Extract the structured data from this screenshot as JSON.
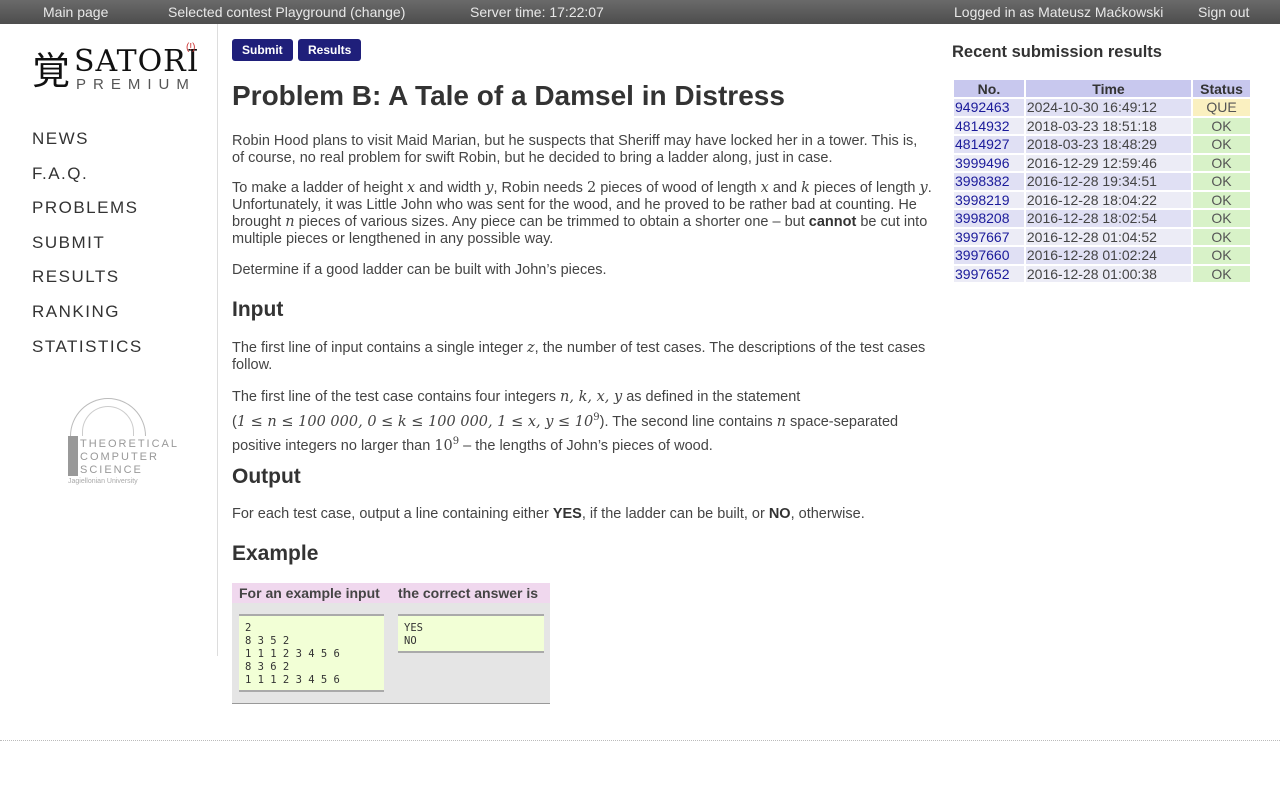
{
  "topbar": {
    "main_page": "Main page",
    "contest": "Selected contest Playground (change)",
    "server_time": "Server time: 17:22:07",
    "logged_in": "Logged in as Mateusz Maćkowski",
    "sign_out": "Sign out"
  },
  "logo": {
    "kanji": "覚",
    "satori": "SATORI",
    "mark": "(!)",
    "premium": "PREMIUM"
  },
  "nav": [
    "NEWS",
    "F.A.Q.",
    "PROBLEMS",
    "SUBMIT",
    "RESULTS",
    "RANKING",
    "STATISTICS"
  ],
  "tcs_logo": {
    "l1": "THEORETICAL",
    "l2": "COMPUTER",
    "l3": "SCIENCE",
    "uni": "Jagiellonian University"
  },
  "buttons": {
    "submit": "Submit",
    "results": "Results"
  },
  "problem": {
    "title": "Problem B: A Tale of a Damsel in Distress",
    "p1": "Robin Hood plans to visit Maid Marian, but he suspects that Sheriff may have locked her in a tower. This is, of course, no real problem for swift Robin, but he decided to bring a ladder along, just in case.",
    "p2a": "To make a ladder of height ",
    "p2b": " and width ",
    "p2c": ", Robin needs ",
    "p2d": " pieces of wood of length ",
    "p2e": " and ",
    "p2f": " pieces of length ",
    "p2g": ". Unfortunately, it was Little John who was sent for the wood, and he proved to be rather bad at counting. He brought ",
    "p2h": " pieces of various sizes. Any piece can be trimmed to obtain a shorter one – but ",
    "p2bold": "cannot",
    "p2i": " be cut into multiple pieces or lengthened in any possible way.",
    "p3": "Determine if a good ladder can be built with John’s pieces.",
    "input_heading": "Input",
    "in1a": "The first line of input contains a single integer ",
    "in1b": ", the number of test cases. The descriptions of the test cases follow.",
    "in2a": "The first line of the test case contains four integers ",
    "in2b": " as defined in the statement",
    "in2c": "(",
    "in2d": "). The second line contains ",
    "in2e": " space-separated",
    "in2f": "positive integers no larger than ",
    "in2g": " – the lengths of John’s pieces of wood.",
    "output_heading": "Output",
    "out1a": "For each test case, output a line containing either ",
    "out1yes": "YES",
    "out1b": ", if the ladder can be built, or ",
    "out1no": "NO",
    "out1c": ", otherwise.",
    "example_heading": "Example",
    "math": {
      "x": "x",
      "y": "y",
      "two": "2",
      "k": "k",
      "n": "n",
      "z": "z",
      "nkxy": "n, k, x, y",
      "constraints": "1 ≤ n ≤ 100 000, 0 ≤ k ≤ 100 000, 1 ≤ x, y ≤ 10",
      "exp9": "9",
      "ten": "10"
    }
  },
  "example": {
    "input_header": "For an example input",
    "output_header": "the correct answer is",
    "input": "2\n8 3 5 2\n1 1 1 2 3 4 5 6\n8 3 6 2\n1 1 1 2 3 4 5 6",
    "output": "YES\nNO"
  },
  "recent": {
    "title": "Recent submission results",
    "headers": [
      "No.",
      "Time",
      "Status"
    ],
    "rows": [
      {
        "no": "9492463",
        "time": "2024-10-30 16:49:12",
        "status": "QUE"
      },
      {
        "no": "4814932",
        "time": "2018-03-23 18:51:18",
        "status": "OK"
      },
      {
        "no": "4814927",
        "time": "2018-03-23 18:48:29",
        "status": "OK"
      },
      {
        "no": "3999496",
        "time": "2016-12-29 12:59:46",
        "status": "OK"
      },
      {
        "no": "3998382",
        "time": "2016-12-28 19:34:51",
        "status": "OK"
      },
      {
        "no": "3998219",
        "time": "2016-12-28 18:04:22",
        "status": "OK"
      },
      {
        "no": "3998208",
        "time": "2016-12-28 18:02:54",
        "status": "OK"
      },
      {
        "no": "3997667",
        "time": "2016-12-28 01:04:52",
        "status": "OK"
      },
      {
        "no": "3997660",
        "time": "2016-12-28 01:02:24",
        "status": "OK"
      },
      {
        "no": "3997652",
        "time": "2016-12-28 01:00:38",
        "status": "OK"
      }
    ]
  },
  "colors": {
    "accent": "#1f1f7a",
    "ok": "#d8f2c8",
    "que": "#faf0c0",
    "table_header": "#c8c8ee"
  }
}
